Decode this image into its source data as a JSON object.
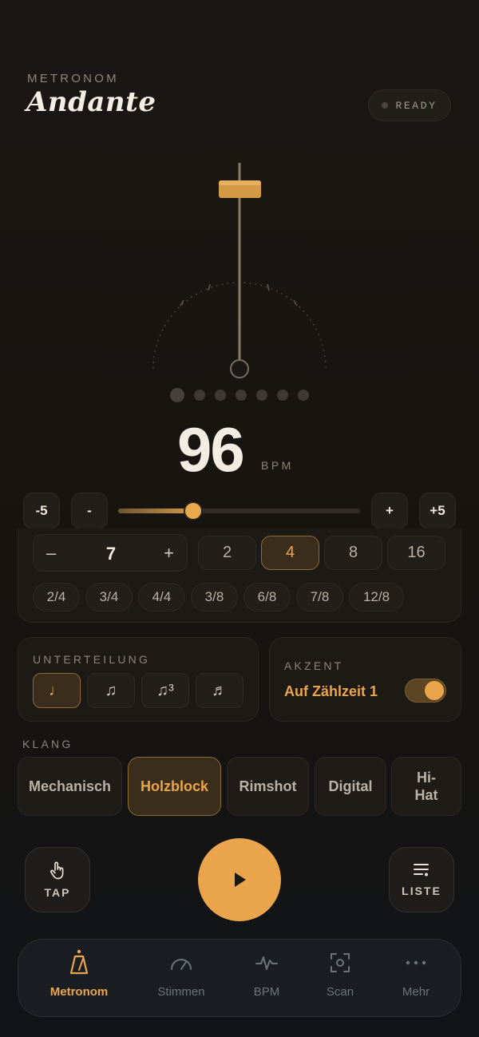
{
  "header": {
    "eyebrow": "METRONOM",
    "title": "Andante",
    "status": "READY"
  },
  "beat_dots": {
    "count": 7,
    "active_index": 0
  },
  "tempo": {
    "bpm": "96",
    "unit": "BPM",
    "slider_fraction": 0.31,
    "buttons": {
      "minus5": "-5",
      "minus1": "-",
      "plus1": "+",
      "plus5": "+5"
    }
  },
  "meter": {
    "beats_minus": "–",
    "beats_value": "7",
    "beats_plus": "+",
    "note_values": [
      {
        "label": "2",
        "active": false
      },
      {
        "label": "4",
        "active": true
      },
      {
        "label": "8",
        "active": false
      },
      {
        "label": "16",
        "active": false
      }
    ],
    "signatures": [
      "2/4",
      "3/4",
      "4/4",
      "3/8",
      "6/8",
      "7/8",
      "12/8"
    ]
  },
  "subdivision": {
    "label": "UNTERTEILUNG",
    "options": [
      {
        "icon": "quarter-note-icon",
        "glyph": "♩",
        "active": true
      },
      {
        "icon": "eighth-notes-icon",
        "glyph": "♫",
        "active": false
      },
      {
        "icon": "triplet-icon",
        "glyph": "♫³",
        "active": false
      },
      {
        "icon": "sixteenth-notes-icon",
        "glyph": "♬",
        "active": false
      }
    ]
  },
  "accent": {
    "label": "AKZENT",
    "text": "Auf Zählzeit 1",
    "enabled": true
  },
  "sound": {
    "label": "KLANG",
    "options": [
      {
        "label": "Mechanisch",
        "active": false
      },
      {
        "label": "Holzblock",
        "active": true
      },
      {
        "label": "Rimshot",
        "active": false
      },
      {
        "label": "Digital",
        "active": false
      },
      {
        "label": "Hi-\nHat",
        "active": false
      }
    ]
  },
  "transport": {
    "tap_label": "TAP",
    "list_label": "LISTE",
    "tap_icon": "hand-pointer-icon",
    "list_icon": "list-icon",
    "play_icon": "play-icon"
  },
  "nav": {
    "items": [
      {
        "label": "Metronom",
        "icon": "metronome-icon",
        "active": true
      },
      {
        "label": "Stimmen",
        "icon": "tuner-gauge-icon",
        "active": false
      },
      {
        "label": "BPM",
        "icon": "waveform-icon",
        "active": false
      },
      {
        "label": "Scan",
        "icon": "scan-icon",
        "active": false
      },
      {
        "label": "Mehr",
        "icon": "more-dots-icon",
        "active": false
      }
    ]
  },
  "colors": {
    "accent": "#eaa54c",
    "background": "#1b1714",
    "card": "#1d1915"
  }
}
